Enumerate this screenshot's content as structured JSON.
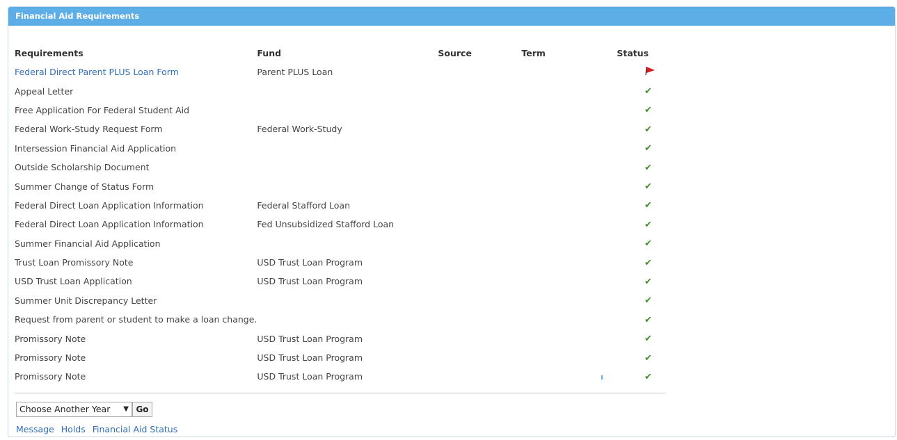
{
  "panel": {
    "title": "Financial Aid Requirements"
  },
  "columns": {
    "requirements": "Requirements",
    "fund": "Fund",
    "source": "Source",
    "term": "Term",
    "status": "Status"
  },
  "rows": [
    {
      "requirement": "Federal Direct Parent PLUS Loan Form",
      "fund": "Parent PLUS Loan",
      "source": "",
      "term": "",
      "status": "flag-icon",
      "link": true
    },
    {
      "requirement": "Appeal Letter",
      "fund": "",
      "source": "",
      "term": "",
      "status": "check-icon"
    },
    {
      "requirement": "Free Application For Federal Student Aid",
      "fund": "",
      "source": "",
      "term": "",
      "status": "check-icon"
    },
    {
      "requirement": "Federal Work-Study Request Form",
      "fund": "Federal Work-Study",
      "source": "",
      "term": "",
      "status": "check-icon"
    },
    {
      "requirement": "Intersession Financial Aid Application",
      "fund": "",
      "source": "",
      "term": "",
      "status": "check-icon"
    },
    {
      "requirement": "Outside Scholarship Document",
      "fund": "",
      "source": "",
      "term": "",
      "status": "check-icon"
    },
    {
      "requirement": "Summer Change of Status Form",
      "fund": "",
      "source": "",
      "term": "",
      "status": "check-icon"
    },
    {
      "requirement": "Federal Direct Loan Application Information",
      "fund": "Federal Stafford Loan",
      "source": "",
      "term": "",
      "status": "check-icon"
    },
    {
      "requirement": "Federal Direct Loan Application Information",
      "fund": "Fed Unsubsidized Stafford Loan",
      "source": "",
      "term": "",
      "status": "check-icon"
    },
    {
      "requirement": "Summer Financial Aid Application",
      "fund": "",
      "source": "",
      "term": "",
      "status": "check-icon"
    },
    {
      "requirement": "Trust Loan Promissory Note",
      "fund": "USD Trust Loan Program",
      "source": "",
      "term": "",
      "status": "check-icon"
    },
    {
      "requirement": "USD Trust Loan Application",
      "fund": "USD Trust Loan Program",
      "source": "",
      "term": "",
      "status": "check-icon"
    },
    {
      "requirement": "Summer Unit Discrepancy Letter",
      "fund": "",
      "source": "",
      "term": "",
      "status": "check-icon"
    },
    {
      "requirement": "Request from parent or student to make a loan change.",
      "fund": "",
      "source": "",
      "term": "",
      "status": "check-icon"
    },
    {
      "requirement": "Promissory Note",
      "fund": "USD Trust Loan Program",
      "source": "",
      "term": "",
      "status": "check-icon"
    },
    {
      "requirement": "Promissory Note",
      "fund": "USD Trust Loan Program",
      "source": "",
      "term": "",
      "status": "check-icon"
    },
    {
      "requirement": "Promissory Note",
      "fund": "USD Trust Loan Program",
      "source": "",
      "term": "",
      "status": "check-icon"
    }
  ],
  "year_select": {
    "value": "Choose Another Year"
  },
  "go_button": {
    "label": "Go"
  },
  "footer_links": [
    "Message",
    "Holds",
    "Financial Aid Status"
  ],
  "colors": {
    "header_bg": "#5dade6",
    "link": "#2f6fb9",
    "check": "#3f8f2c",
    "flag": "#d42020"
  }
}
